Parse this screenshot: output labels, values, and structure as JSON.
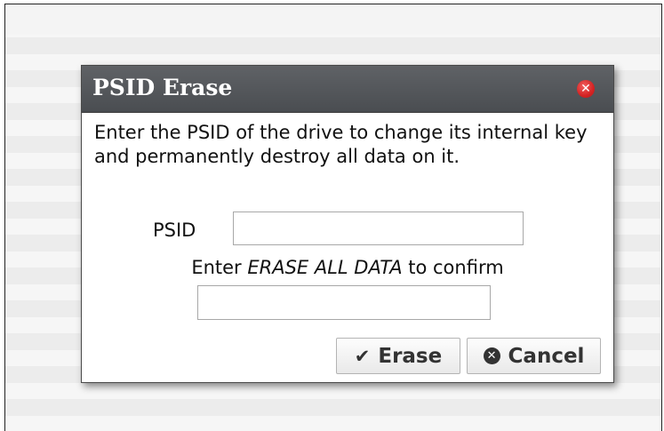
{
  "dialog": {
    "title": "PSID Erase",
    "description": "Enter the PSID of the drive to change its internal key and permanently destroy all data on it.",
    "psid_label": "PSID",
    "psid_value": "",
    "confirm_prefix": "Enter ",
    "confirm_keyword": "ERASE ALL DATA",
    "confirm_suffix": " to confirm",
    "confirm_value": "",
    "erase_label": "Erase",
    "cancel_label": "Cancel",
    "close_glyph": "✕",
    "check_glyph": "✔",
    "cancel_glyph": "✕"
  },
  "colors": {
    "titlebar": "#4f5256",
    "close_button": "#d42323"
  },
  "icons": {
    "close": "close-icon",
    "erase": "check-icon",
    "cancel": "times-circle-icon"
  }
}
